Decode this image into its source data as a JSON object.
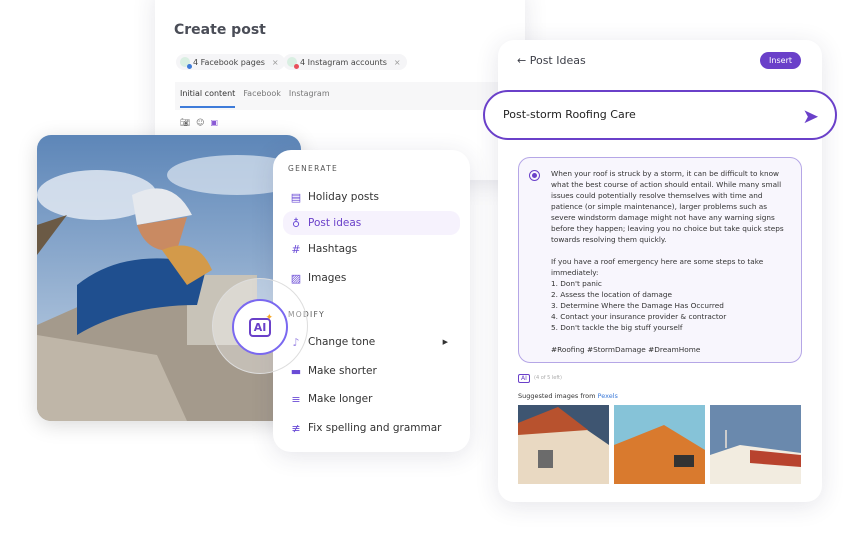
{
  "create_post": {
    "title": "Create post",
    "chips": [
      {
        "label": "4 Facebook pages",
        "badge": "#3d7bd9"
      },
      {
        "label": "4 Instagram accounts",
        "badge": "#e8505b"
      }
    ],
    "chip_close": "×",
    "tabs": [
      "Initial content",
      "Facebook",
      "Instagram"
    ],
    "active_tab": "Initial content",
    "tools": [
      "camera-icon",
      "emoji-icon",
      "ai-icon"
    ]
  },
  "menu": {
    "generate_label": "GENERATE",
    "generate": [
      {
        "label": "Holiday posts",
        "icon": "calendar-icon"
      },
      {
        "label": "Post ideas",
        "icon": "lightbulb-icon",
        "active": true
      },
      {
        "label": "Hashtags",
        "icon": "hashtag-icon"
      },
      {
        "label": "Images",
        "icon": "image-icon"
      }
    ],
    "modify_label": "MODIFY",
    "modify": [
      {
        "label": "Change tone",
        "icon": "tone-icon",
        "submenu": true
      },
      {
        "label": "Make shorter",
        "icon": "short-lines-icon"
      },
      {
        "label": "Make longer",
        "icon": "long-lines-icon"
      },
      {
        "label": "Fix spelling and grammar",
        "icon": "spellcheck-icon"
      }
    ]
  },
  "ai_button": {
    "label": "AI"
  },
  "panel": {
    "back_label": "Post Ideas",
    "insert_label": "Insert",
    "prompt": "Post-storm Roofing Care",
    "result": "When your roof is struck by a storm, it can be difficult to know what the best course of action should entail. While many small issues could potentially resolve themselves with time and patience (or simple maintenance), larger problems such as severe windstorm damage might not have any warning signs before they happen; leaving you no choice but take quick steps towards resolving them quickly.\n\nIf you have a roof emergency here are some steps to take immediately:\n1. Don't panic\n2. Assess the location of damage\n3. Determine Where the Damage Has Occurred\n4. Contact your insurance provider & contractor\n5. Don't tackle the big stuff yourself\n\n#Roofing #StormDamage #DreamHome",
    "ai_tag": "AI",
    "credits": "(4 of 5 left)",
    "suggested_prefix": "Suggested images from ",
    "suggested_source": "Pexels"
  },
  "colors": {
    "accent": "#6a40c9",
    "link": "#3d7bd9"
  }
}
